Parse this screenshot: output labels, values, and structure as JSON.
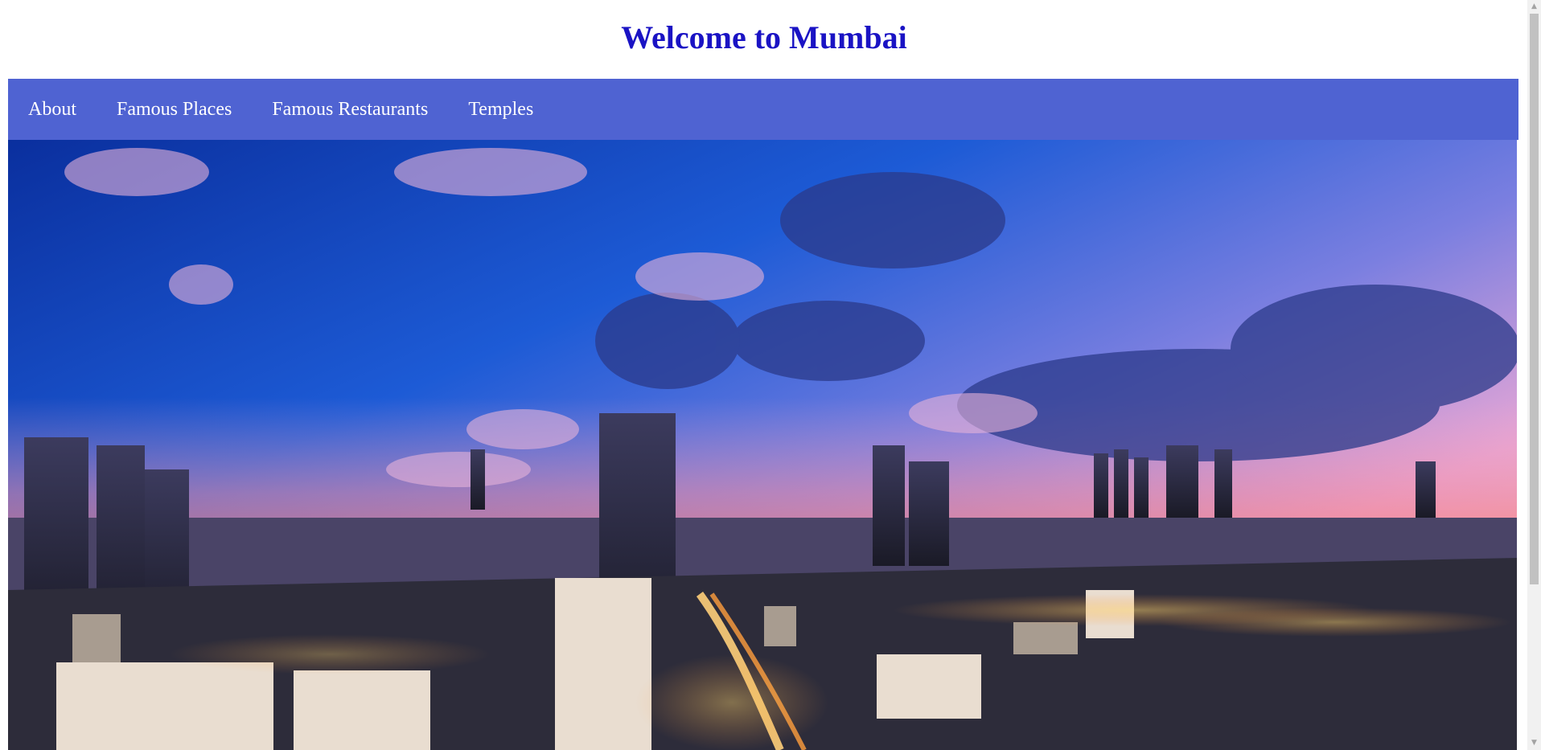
{
  "header": {
    "title": "Welcome to Mumbai"
  },
  "nav": {
    "items": [
      {
        "label": "About"
      },
      {
        "label": "Famous Places"
      },
      {
        "label": "Famous Restaurants"
      },
      {
        "label": "Temples"
      }
    ]
  },
  "colors": {
    "title": "#1a13c4",
    "navbar_bg": "#4f63d2",
    "nav_text": "#ffffff"
  },
  "hero": {
    "subject": "mumbai-skyline-at-dusk-photo"
  },
  "icons": {
    "scroll_up": "triangle-up",
    "scroll_down": "triangle-down"
  }
}
